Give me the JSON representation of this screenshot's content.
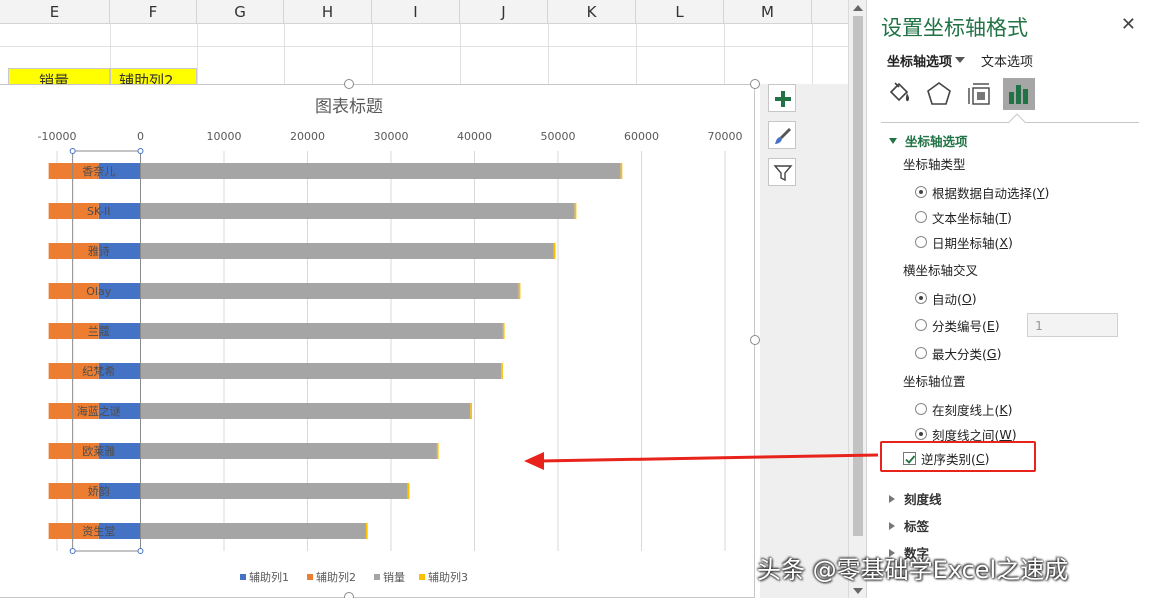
{
  "sheet": {
    "columns": [
      "E",
      "F",
      "G",
      "H",
      "I",
      "J",
      "K",
      "L",
      "M"
    ],
    "header_cells": [
      "销量",
      "辅助列2"
    ]
  },
  "chart_data": {
    "type": "bar",
    "title": "图表标题",
    "categories": [
      "香奈儿",
      "SK-II",
      "雅诗",
      "Olay",
      "兰蔻",
      "纪梵希",
      "海蓝之谜",
      "欧莱雅",
      "娇韵",
      "资生堂"
    ],
    "xlim": [
      -10000,
      70000
    ],
    "x_ticks": [
      -10000,
      0,
      10000,
      20000,
      30000,
      40000,
      50000,
      60000,
      70000
    ],
    "x_tick_labels": [
      "-10000",
      "0",
      "10000",
      "20000",
      "30000",
      "40000",
      "50000",
      "60000",
      "70000"
    ],
    "stacked": true,
    "series": [
      {
        "name": "辅助列1",
        "color": "#4472c4",
        "values": [
          -5000,
          -5000,
          -5000,
          -5000,
          -5000,
          -5000,
          -5000,
          -5000,
          -5000,
          -5000
        ]
      },
      {
        "name": "辅助列2",
        "color": "#ed7d31",
        "values": [
          -6000,
          -6000,
          -6000,
          -6000,
          -6000,
          -6000,
          -6000,
          -6000,
          -6000,
          -6000
        ]
      },
      {
        "name": "销量",
        "color": "#a5a5a5",
        "values": [
          57500,
          52000,
          49500,
          45300,
          43400,
          43200,
          39500,
          35500,
          32000,
          27000
        ]
      },
      {
        "name": "辅助列3",
        "color": "#ffc000",
        "values": [
          200,
          200,
          200,
          200,
          200,
          200,
          200,
          200,
          200,
          200
        ]
      }
    ],
    "legend_position": "bottom",
    "grid": true,
    "category_order": "reversed"
  },
  "chart_tools": {
    "elements_icon": "plus-icon",
    "styles_icon": "brush-icon",
    "filters_icon": "filter-icon"
  },
  "pane": {
    "title": "设置坐标轴格式",
    "tabs": [
      "坐标轴选项",
      "文本选项"
    ],
    "icons": [
      "fill-line-icon",
      "effects-icon",
      "size-properties-icon",
      "axis-options-icon"
    ],
    "section_axis_options": "坐标轴选项",
    "axis_type_label": "坐标轴类型",
    "axis_type_options": [
      {
        "label": "根据数据自动选择(",
        "key": "Y",
        "end": ")",
        "selected": true
      },
      {
        "label": "文本坐标轴(",
        "key": "T",
        "end": ")",
        "selected": false
      },
      {
        "label": "日期坐标轴(",
        "key": "X",
        "end": ")",
        "selected": false
      }
    ],
    "cross_label": "横坐标轴交叉",
    "cross_options": [
      {
        "label": "自动(",
        "key": "O",
        "end": ")",
        "selected": true
      },
      {
        "label": "分类编号(",
        "key": "E",
        "end": ")",
        "selected": false
      },
      {
        "label": "最大分类(",
        "key": "G",
        "end": ")",
        "selected": false
      }
    ],
    "cross_value": "1",
    "position_label": "坐标轴位置",
    "position_options": [
      {
        "label": "在刻度线上(",
        "key": "K",
        "end": ")",
        "selected": false
      },
      {
        "label": "刻度线之间(",
        "key": "W",
        "end": ")",
        "selected": true
      }
    ],
    "reverse": {
      "label": "逆序类别(",
      "key": "C",
      "end": ")",
      "checked": true
    },
    "collapsed_sections": [
      "刻度线",
      "标签",
      "数字"
    ],
    "accent": "#217346"
  },
  "annotation": {
    "arrow_color": "#e8231b",
    "watermark": "头条 @零基础学Excel之速成"
  }
}
